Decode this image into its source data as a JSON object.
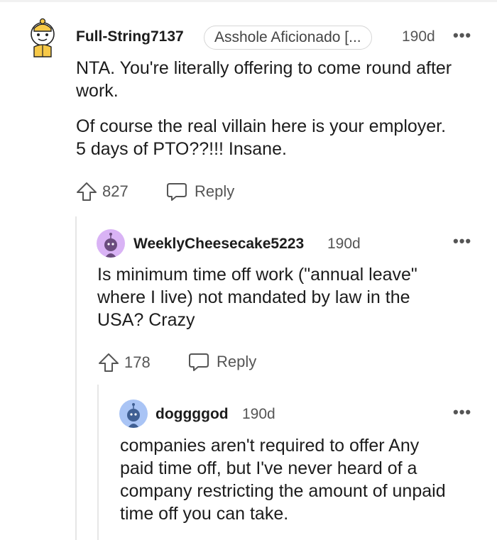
{
  "comments": [
    {
      "username": "Full-String7137",
      "flair": "Asshole Aficionado [...",
      "age": "190d",
      "more": "•••",
      "paragraphs": [
        "NTA. You're literally offering to come round after work.",
        "Of course the real villain here is your employer. 5 days of PTO??!!! Insane."
      ],
      "upvotes": "827",
      "reply_label": "Reply",
      "avatar_icon": "snoo-avatar-yellow-icon"
    },
    {
      "username": "WeeklyCheesecake5223",
      "age": "190d",
      "more": "•••",
      "paragraphs": [
        "Is minimum time off work (\"annual leave\" where I live) not mandated by law in the USA? Crazy"
      ],
      "upvotes": "178",
      "reply_label": "Reply",
      "avatar_icon": "snoo-avatar-purple-icon"
    },
    {
      "username": "doggggod",
      "age": "190d",
      "more": "•••",
      "paragraphs": [
        "companies aren't required to offer Any paid time off, but I've never heard of a company restricting the amount of unpaid time off you can take."
      ],
      "avatar_icon": "snoo-avatar-blue-icon"
    }
  ],
  "colors": {
    "thread_line": "#e6e6e6",
    "text": "#1c1c1c",
    "meta": "#555555"
  }
}
